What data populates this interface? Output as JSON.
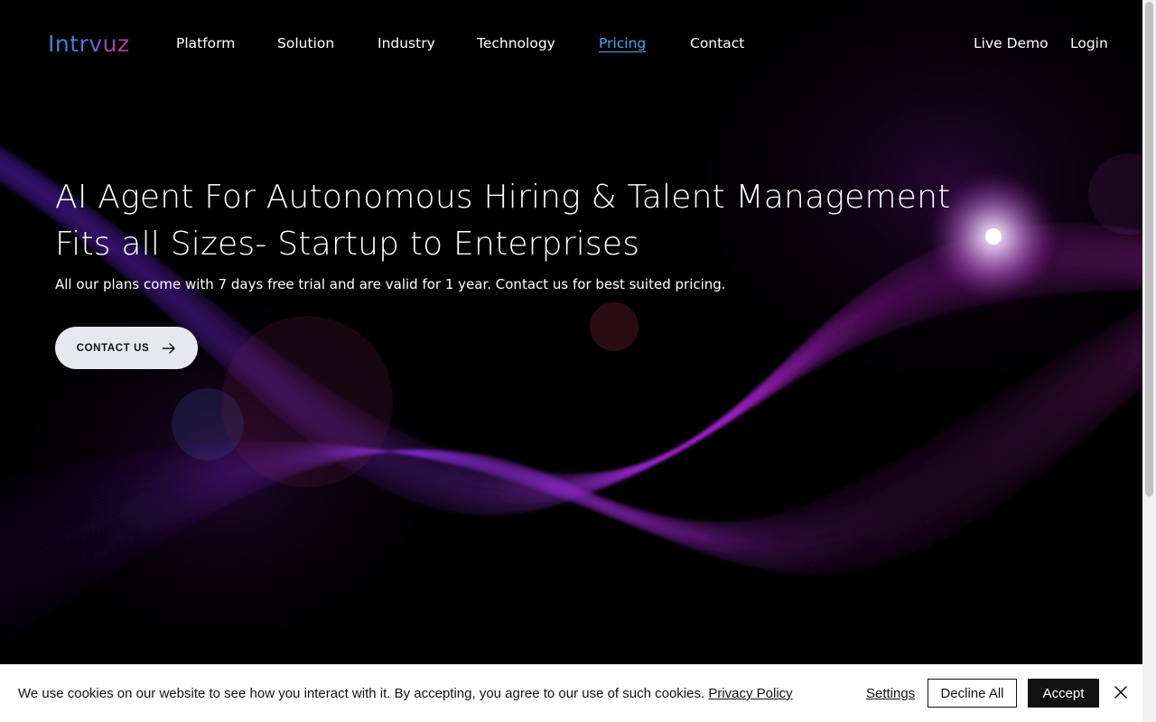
{
  "brand": {
    "logo_text": "Intrvuz"
  },
  "nav": {
    "items": [
      {
        "label": "Platform",
        "active": false
      },
      {
        "label": "Solution",
        "active": false
      },
      {
        "label": "Industry",
        "active": false
      },
      {
        "label": "Technology",
        "active": false
      },
      {
        "label": "Pricing",
        "active": true
      },
      {
        "label": "Contact",
        "active": false
      }
    ],
    "live_demo": "Live Demo",
    "login": "Login"
  },
  "hero": {
    "title_line1": "AI Agent For Autonomous Hiring & Talent Management",
    "title_line2": "Fits all Sizes- Startup to Enterprises",
    "subtitle": "All our plans come with 7 days free trial and are valid for 1 year. Contact us for best suited pricing.",
    "cta_label": "CONTACT US",
    "cta_icon": "arrow-right-icon"
  },
  "cookie_banner": {
    "text": "We use cookies on our website to see how you interact with it. By accepting, you agree to our use of such cookies.",
    "privacy_link": "Privacy Policy",
    "settings": "Settings",
    "decline": "Decline All",
    "accept": "Accept",
    "close_icon": "close-icon"
  },
  "colors": {
    "background": "#000000",
    "accent_link": "#4aa3f0",
    "wave_purple": "#8a2be2",
    "wave_magenta": "#d21bd8",
    "cta_bg": "#e6e8ec"
  }
}
